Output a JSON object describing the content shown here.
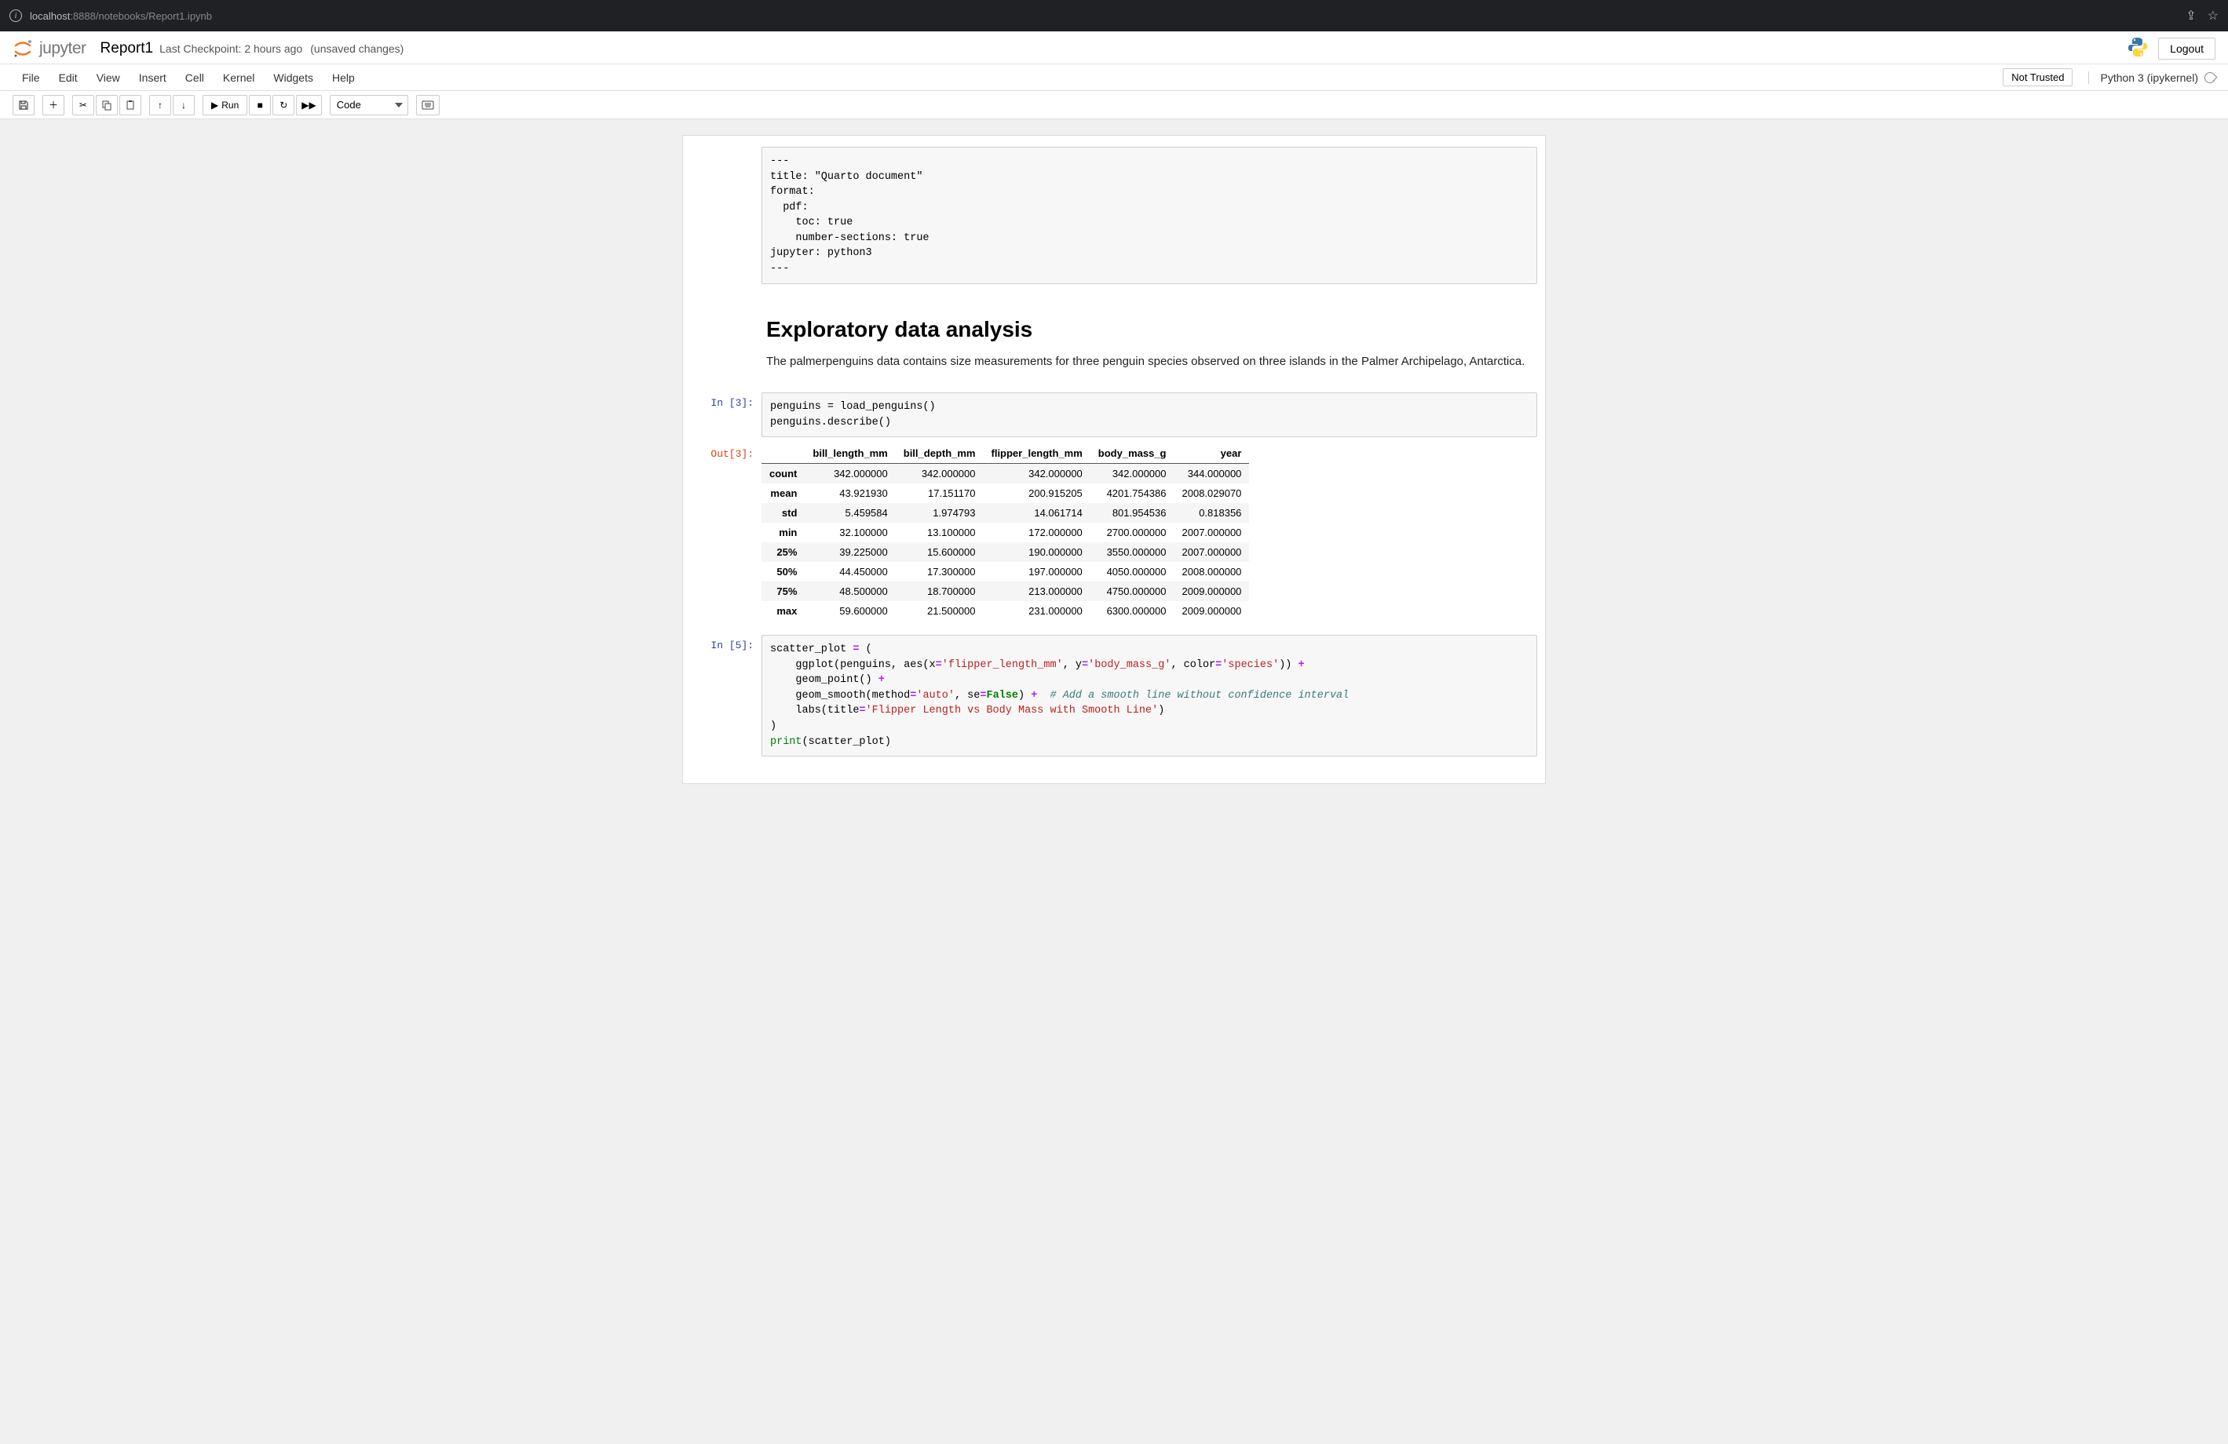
{
  "browser": {
    "url_host": "localhost",
    "url_port": ":8888",
    "url_path": "/notebooks/Report1.ipynb"
  },
  "header": {
    "app": "jupyter",
    "title": "Report1",
    "checkpoint": "Last Checkpoint: 2 hours ago",
    "unsaved": "(unsaved changes)",
    "logout": "Logout"
  },
  "menu": {
    "items": [
      "File",
      "Edit",
      "View",
      "Insert",
      "Cell",
      "Kernel",
      "Widgets",
      "Help"
    ],
    "trust": "Not Trusted",
    "kernel": "Python 3 (ipykernel)"
  },
  "toolbar": {
    "run": "Run",
    "celltype": "Code"
  },
  "cells": {
    "raw": "---\ntitle: \"Quarto document\"\nformat:\n  pdf:\n    toc: true\n    number-sections: true\njupyter: python3\n---",
    "md_heading": "Exploratory data analysis",
    "md_para": "The palmerpenguins data contains size measurements for three penguin species observed on three islands in the Palmer Archipelago, Antarctica.",
    "in3_prompt": "In [3]:",
    "in3_code": "penguins = load_penguins()\npenguins.describe()",
    "out3_prompt": "Out[3]:",
    "describe_cols": [
      "bill_length_mm",
      "bill_depth_mm",
      "flipper_length_mm",
      "body_mass_g",
      "year"
    ],
    "describe_rows": [
      {
        "label": "count",
        "vals": [
          "342.000000",
          "342.000000",
          "342.000000",
          "342.000000",
          "344.000000"
        ]
      },
      {
        "label": "mean",
        "vals": [
          "43.921930",
          "17.151170",
          "200.915205",
          "4201.754386",
          "2008.029070"
        ]
      },
      {
        "label": "std",
        "vals": [
          "5.459584",
          "1.974793",
          "14.061714",
          "801.954536",
          "0.818356"
        ]
      },
      {
        "label": "min",
        "vals": [
          "32.100000",
          "13.100000",
          "172.000000",
          "2700.000000",
          "2007.000000"
        ]
      },
      {
        "label": "25%",
        "vals": [
          "39.225000",
          "15.600000",
          "190.000000",
          "3550.000000",
          "2007.000000"
        ]
      },
      {
        "label": "50%",
        "vals": [
          "44.450000",
          "17.300000",
          "197.000000",
          "4050.000000",
          "2008.000000"
        ]
      },
      {
        "label": "75%",
        "vals": [
          "48.500000",
          "18.700000",
          "213.000000",
          "4750.000000",
          "2009.000000"
        ]
      },
      {
        "label": "max",
        "vals": [
          "59.600000",
          "21.500000",
          "231.000000",
          "6300.000000",
          "2009.000000"
        ]
      }
    ],
    "in5_prompt": "In [5]:",
    "in5": {
      "l1a": "scatter_plot ",
      "l1b": "=",
      "l1c": " (",
      "l2a": "    ggplot(penguins, aes(x",
      "l2b": "=",
      "l2c": "'flipper_length_mm'",
      "l2d": ", y",
      "l2e": "=",
      "l2f": "'body_mass_g'",
      "l2g": ", color",
      "l2h": "=",
      "l2i": "'species'",
      "l2j": ")) ",
      "l2k": "+",
      "l3a": "    geom_point() ",
      "l3b": "+",
      "l4a": "    geom_smooth(method",
      "l4b": "=",
      "l4c": "'auto'",
      "l4d": ", se",
      "l4e": "=",
      "l4f": "False",
      "l4g": ") ",
      "l4h": "+",
      "l4i": "  ",
      "l4j": "# Add a smooth line without confidence interval",
      "l5a": "    labs(title",
      "l5b": "=",
      "l5c": "'Flipper Length vs Body Mass with Smooth Line'",
      "l5d": ")",
      "l6": ")",
      "l7a": "print",
      "l7b": "(scatter_plot)"
    }
  }
}
